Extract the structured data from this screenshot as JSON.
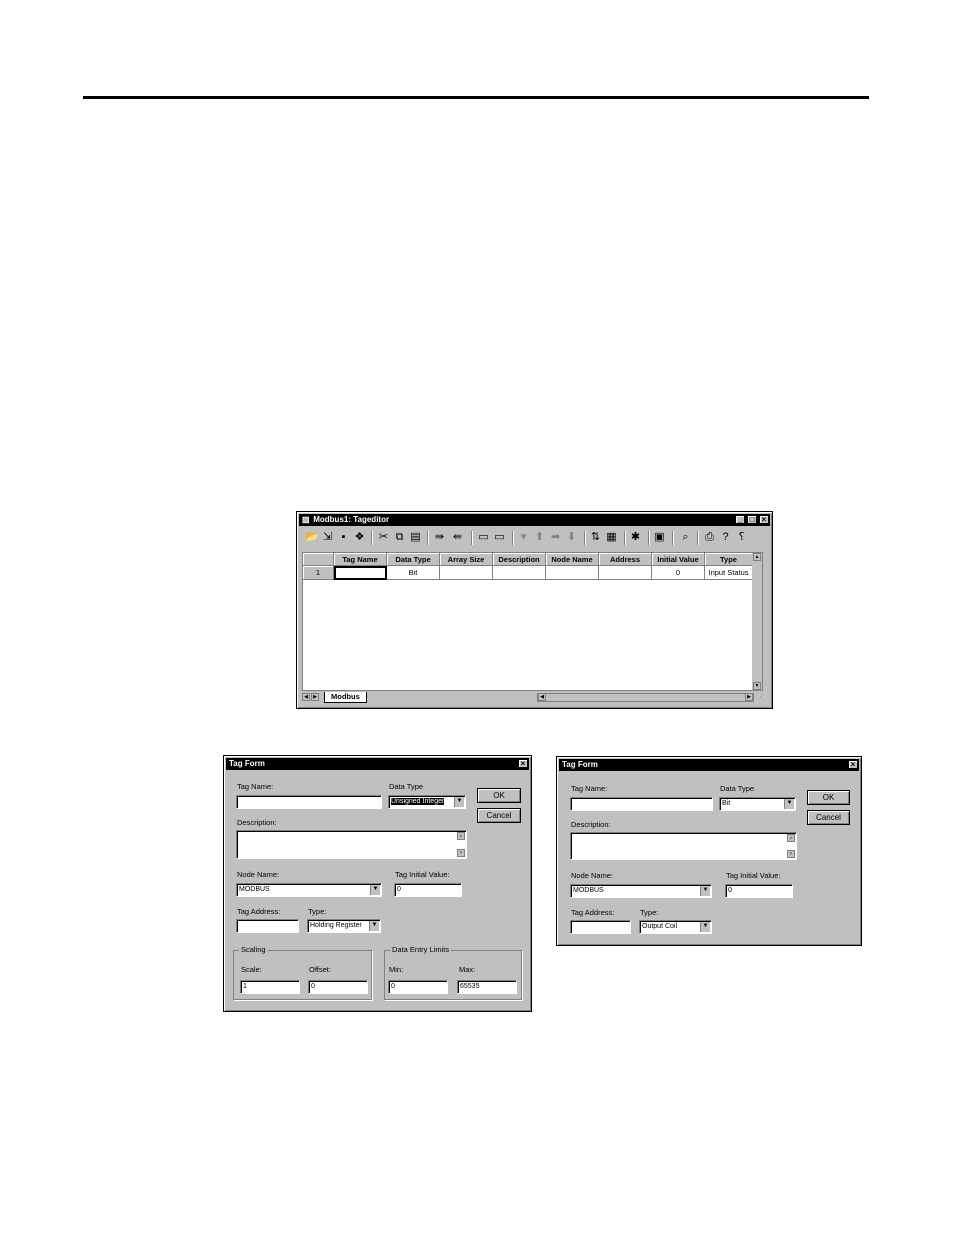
{
  "tageditor": {
    "title": "Modbus1: Tageditor",
    "toolbar_icons": [
      "open-icon",
      "import-icon",
      "save-icon",
      "print-setup-icon",
      "cut-icon",
      "copy-icon",
      "paste-icon",
      "insert-row-icon",
      "delete-row-icon",
      "copy-rows-icon",
      "paste-rows-icon",
      "fill-icon",
      "up-icon",
      "right-icon",
      "down-icon",
      "sort-icon",
      "export-icon",
      "tools-icon",
      "form-icon",
      "find-icon",
      "print-icon",
      "help-icon",
      "context-help-icon"
    ],
    "columns": [
      "Tag Name",
      "Data Type",
      "Array Size",
      "Description",
      "Node Name",
      "Address",
      "Initial Value",
      "Type"
    ],
    "rows": [
      {
        "num": "1",
        "tag_name": "",
        "data_type": "Bit",
        "array_size": "",
        "description": "",
        "node_name": "",
        "address": "",
        "initial_value": "0",
        "type": "Input Status"
      }
    ],
    "sheet_tab": "Modbus"
  },
  "form1": {
    "title": "Tag Form",
    "tag_name_label": "Tag Name:",
    "tag_name_value": "",
    "data_type_label": "Data Type",
    "data_type_value": "Unsigned Integer",
    "ok_label": "OK",
    "cancel_label": "Cancel",
    "description_label": "Description:",
    "node_name_label": "Node Name:",
    "node_name_value": "MODBUS",
    "tag_initial_value_label": "Tag Initial Value:",
    "tag_initial_value": "0",
    "tag_address_label": "Tag Address:",
    "tag_address_value": "",
    "type_label": "Type:",
    "type_value": "Holding Register",
    "scaling_label": "Scaling",
    "scale_label": "Scale:",
    "scale_value": "1",
    "offset_label": "Offset:",
    "offset_value": "0",
    "limits_label": "Data Entry Limits",
    "min_label": "Min:",
    "min_value": "0",
    "max_label": "Max:",
    "max_value": "65535"
  },
  "form2": {
    "title": "Tag Form",
    "tag_name_label": "Tag Name:",
    "tag_name_value": "",
    "data_type_label": "Data Type",
    "data_type_value": "Bit",
    "ok_label": "OK",
    "cancel_label": "Cancel",
    "description_label": "Description:",
    "node_name_label": "Node Name:",
    "node_name_value": "MODBUS",
    "tag_initial_value_label": "Tag Initial Value:",
    "tag_initial_value": "0",
    "tag_address_label": "Tag Address:",
    "tag_address_value": "",
    "type_label": "Type:",
    "type_value": "Output Coil"
  }
}
